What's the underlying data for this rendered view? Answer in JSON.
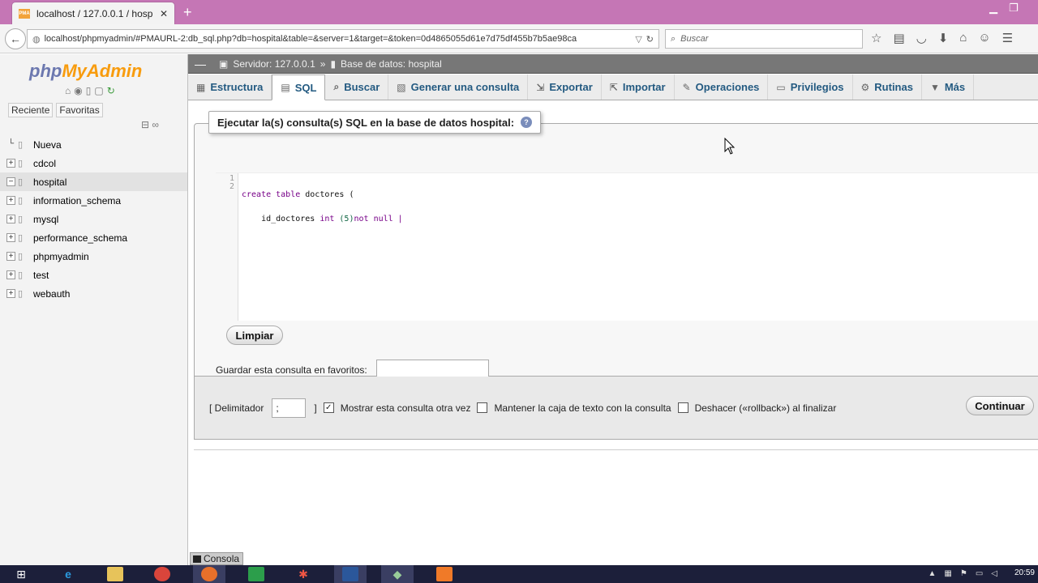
{
  "browser": {
    "tab_title": "localhost / 127.0.0.1 / hosp...",
    "tab_favicon_text": "PMA",
    "url": "localhost/phpmyadmin/#PMAURL-2:db_sql.php?db=hospital&table=&server=1&target=&token=0d4865055d61e7d75df455b7b5ae98ca",
    "search_placeholder": "Buscar"
  },
  "sidebar": {
    "logo_php": "php",
    "logo_myadmin": "MyAdmin",
    "recent_label": "Reciente",
    "favorites_label": "Favoritas",
    "items": [
      {
        "label": "Nueva",
        "expander": "none"
      },
      {
        "label": "cdcol",
        "expander": "+"
      },
      {
        "label": "hospital",
        "expander": "−",
        "active": true
      },
      {
        "label": "information_schema",
        "expander": "+"
      },
      {
        "label": "mysql",
        "expander": "+"
      },
      {
        "label": "performance_schema",
        "expander": "+"
      },
      {
        "label": "phpmyadmin",
        "expander": "+"
      },
      {
        "label": "test",
        "expander": "+"
      },
      {
        "label": "webauth",
        "expander": "+"
      }
    ]
  },
  "breadcrumb": {
    "server": "Servidor: 127.0.0.1",
    "separator": "»",
    "database": "Base de datos: hospital"
  },
  "tabs": [
    {
      "label": "Estructura",
      "icon": "structure-icon",
      "glyph": "▦"
    },
    {
      "label": "SQL",
      "icon": "sql-icon",
      "glyph": "▤",
      "active": true
    },
    {
      "label": "Buscar",
      "icon": "search-icon",
      "glyph": "⌕"
    },
    {
      "label": "Generar una consulta",
      "icon": "query-icon",
      "glyph": "▧"
    },
    {
      "label": "Exportar",
      "icon": "export-icon",
      "glyph": "⇲"
    },
    {
      "label": "Importar",
      "icon": "import-icon",
      "glyph": "⇱"
    },
    {
      "label": "Operaciones",
      "icon": "wrench-icon",
      "glyph": "✎"
    },
    {
      "label": "Privilegios",
      "icon": "privileges-icon",
      "glyph": "▭"
    },
    {
      "label": "Rutinas",
      "icon": "routines-icon",
      "glyph": "⚙"
    },
    {
      "label": "Más",
      "icon": "chevron-down-icon",
      "glyph": "▼"
    }
  ],
  "sql_panel": {
    "legend": "Ejecutar la(s) consulta(s) SQL en la base de datos hospital:",
    "line_numbers": [
      "1",
      "2"
    ],
    "code_line1_kw": "create table",
    "code_line1_rest": " doctores (",
    "code_line2_indent": "    id_doctores ",
    "code_line2_type": "int",
    "code_line2_num": " (5)",
    "code_line2_rest": "not null |",
    "clear_button": "Limpiar",
    "favorite_label": "Guardar esta consulta en favoritos:",
    "favorite_value": ""
  },
  "options": {
    "delimiter_label": "[ Delimitador",
    "delimiter_value": ";",
    "delimiter_close": "]",
    "show_query_label": "Mostrar esta consulta otra vez",
    "show_query_checked": true,
    "keep_text_label": "Mantener la caja de texto con la consulta",
    "rollback_label": "Deshacer («rollback») al finalizar",
    "go_button": "Continuar"
  },
  "console_label": "Consola",
  "taskbar": {
    "clock": "20:59"
  }
}
